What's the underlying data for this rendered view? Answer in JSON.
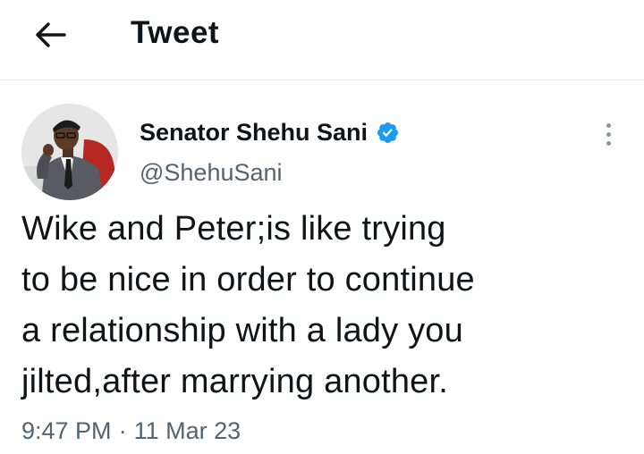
{
  "header": {
    "title": "Tweet",
    "back_icon": "arrow-left-icon"
  },
  "tweet": {
    "author": {
      "display_name": "Senator Shehu Sani",
      "handle": "@ShehuSani",
      "verified": true,
      "verified_color": "#1d9bf0"
    },
    "text": "Wike and Peter;is like trying\nto be nice in order to continue\na relationship with a lady you\njilted,after marrying another.",
    "time": "9:47 PM",
    "separator": "·",
    "date": "11 Mar 23",
    "more_icon": "more-vertical-icon"
  },
  "colors": {
    "text": "#0f1419",
    "secondary": "#536471",
    "divider": "#e3e6e8",
    "accent": "#1d9bf0"
  }
}
